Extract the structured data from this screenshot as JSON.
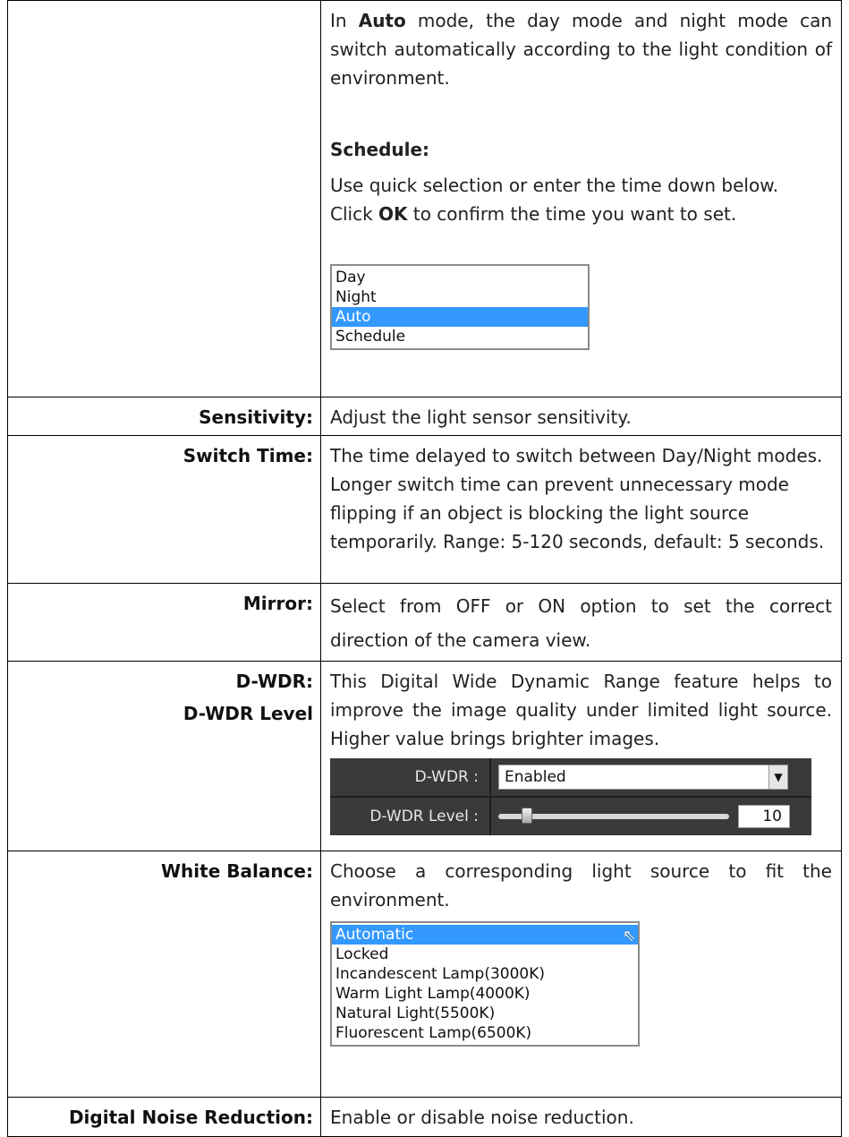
{
  "intro": {
    "auto_pre": "In ",
    "auto_bold": "Auto",
    "auto_post": " mode, the day mode and night mode can switch automatically according to the light condition of environment.",
    "schedule_heading": "Schedule:",
    "schedule_line1": "Use quick selection or enter the time down below.",
    "click_pre": "Click ",
    "click_bold": "OK",
    "click_post": " to confirm the time you want to set.",
    "mode_options": [
      "Day",
      "Night",
      "Auto",
      "Schedule"
    ],
    "mode_selected": "Auto"
  },
  "sensitivity": {
    "label": "Sensitivity:",
    "text": "Adjust the light sensor sensitivity."
  },
  "switch_time": {
    "label": "Switch Time:",
    "text": "The time delayed to switch between Day/Night modes.  Longer switch time can prevent unnecessary mode flipping if an object is blocking the light source temporarily. Range: 5-120 seconds, default: 5 seconds."
  },
  "mirror": {
    "label": "Mirror:",
    "text": "Select from OFF or ON option to set the correct direction of the camera view."
  },
  "dwdr": {
    "label1": "D-WDR:",
    "label2": "D-WDR Level",
    "text": "This Digital Wide Dynamic Range feature helps to improve the image quality under limited light source. Higher value brings brighter images.",
    "panel": {
      "dwdr_label": "D-WDR :",
      "dwdr_value": "Enabled",
      "level_label": "D-WDR Level :",
      "level_value": "10",
      "level_fraction": 0.1
    }
  },
  "white_balance": {
    "label": "White Balance:",
    "text": "Choose a corresponding light source to fit the environment.",
    "options": [
      "Automatic",
      "Locked",
      "Incandescent Lamp(3000K)",
      "Warm Light Lamp(4000K)",
      "Natural Light(5500K)",
      "Fluorescent Lamp(6500K)"
    ],
    "selected": "Automatic"
  },
  "noise": {
    "label": "Digital Noise Reduction:",
    "text": "Enable or disable noise reduction."
  },
  "colors": {
    "selection": "#3399ff",
    "panel_bg": "#3a3a3a"
  }
}
